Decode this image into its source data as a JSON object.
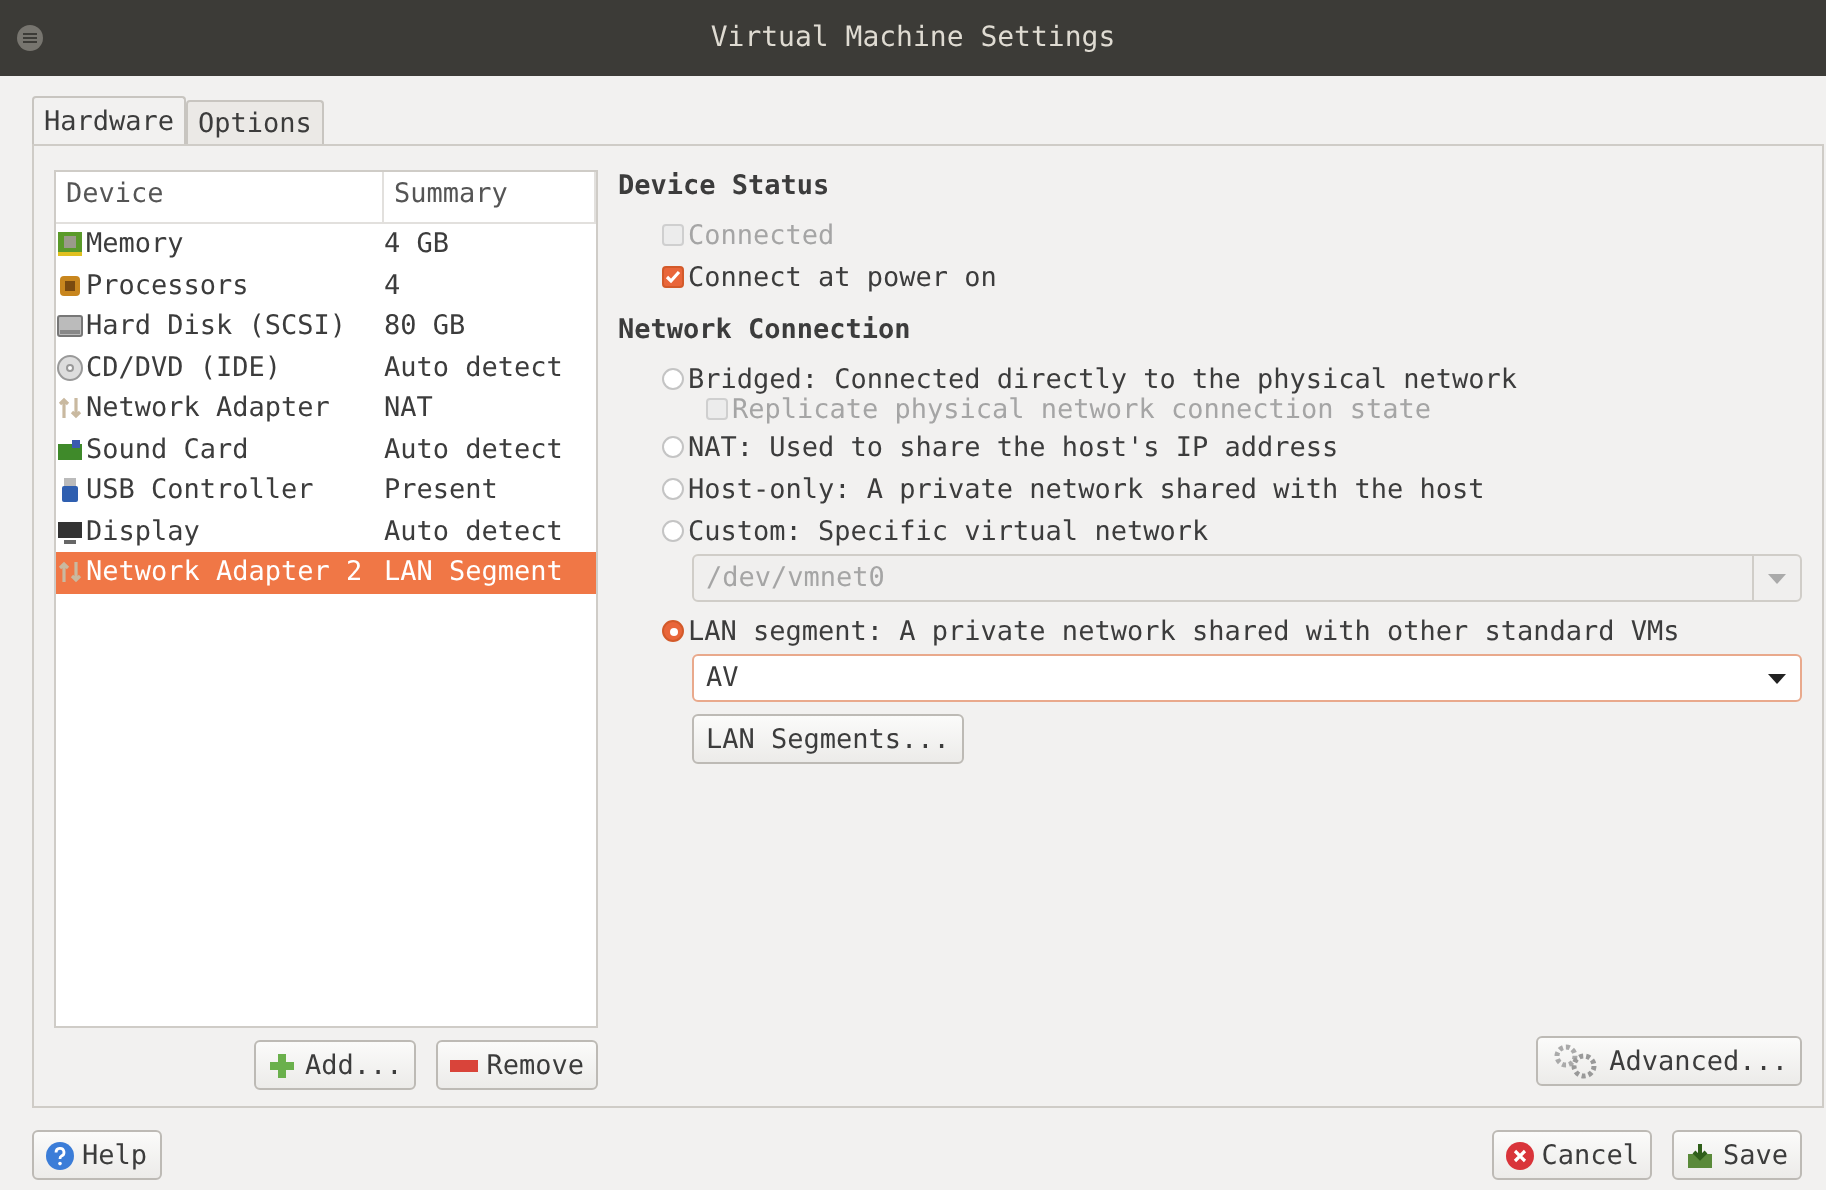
{
  "window": {
    "title": "Virtual Machine Settings"
  },
  "tabs": [
    {
      "label": "Hardware",
      "selected": true
    },
    {
      "label": "Options",
      "selected": false
    }
  ],
  "device_table": {
    "columns": [
      "Device",
      "Summary"
    ],
    "rows": [
      {
        "kind": "memory",
        "device": "Memory",
        "summary": "4 GB",
        "selected": false
      },
      {
        "kind": "cpu",
        "device": "Processors",
        "summary": "4",
        "selected": false
      },
      {
        "kind": "disk",
        "device": "Hard Disk (SCSI)",
        "summary": "80 GB",
        "selected": false
      },
      {
        "kind": "cdrom",
        "device": "CD/DVD (IDE)",
        "summary": "Auto detect",
        "selected": false
      },
      {
        "kind": "network",
        "device": "Network Adapter",
        "summary": "NAT",
        "selected": false
      },
      {
        "kind": "sound",
        "device": "Sound Card",
        "summary": "Auto detect",
        "selected": false
      },
      {
        "kind": "usb",
        "device": "USB Controller",
        "summary": "Present",
        "selected": false
      },
      {
        "kind": "display",
        "device": "Display",
        "summary": "Auto detect",
        "selected": false
      },
      {
        "kind": "network",
        "device": "Network Adapter 2",
        "summary": "LAN Segment",
        "selected": true
      }
    ]
  },
  "list_buttons": [
    {
      "kind": "add",
      "label": "Add..."
    },
    {
      "kind": "remove",
      "label": "Remove"
    }
  ],
  "device_status": {
    "title": "Device Status",
    "options": [
      {
        "label": "Connected",
        "checked": false,
        "disabled": true
      },
      {
        "label": "Connect at power on",
        "checked": true,
        "disabled": false
      }
    ]
  },
  "network_connection": {
    "title": "Network Connection",
    "options": [
      {
        "label": "Bridged: Connected directly to the physical network",
        "selected": false,
        "sub_checkbox": {
          "label": "Replicate physical network connection state",
          "checked": false,
          "disabled": true
        }
      },
      {
        "label": "NAT: Used to share the host's IP address",
        "selected": false
      },
      {
        "label": "Host-only: A private network shared with the host",
        "selected": false
      },
      {
        "label": "Custom: Specific virtual network",
        "selected": false,
        "dropdown": {
          "value": "/dev/vmnet0",
          "disabled": true
        }
      },
      {
        "label": "LAN segment: A private network shared with other standard VMs",
        "selected": true,
        "dropdown": {
          "value": "AV",
          "disabled": false
        },
        "button": "LAN Segments..."
      }
    ]
  },
  "advanced_button": "Advanced...",
  "footer_buttons": [
    {
      "kind": "help",
      "label": "Help"
    },
    {
      "kind": "cancel",
      "label": "Cancel"
    },
    {
      "kind": "save",
      "label": "Save"
    }
  ]
}
